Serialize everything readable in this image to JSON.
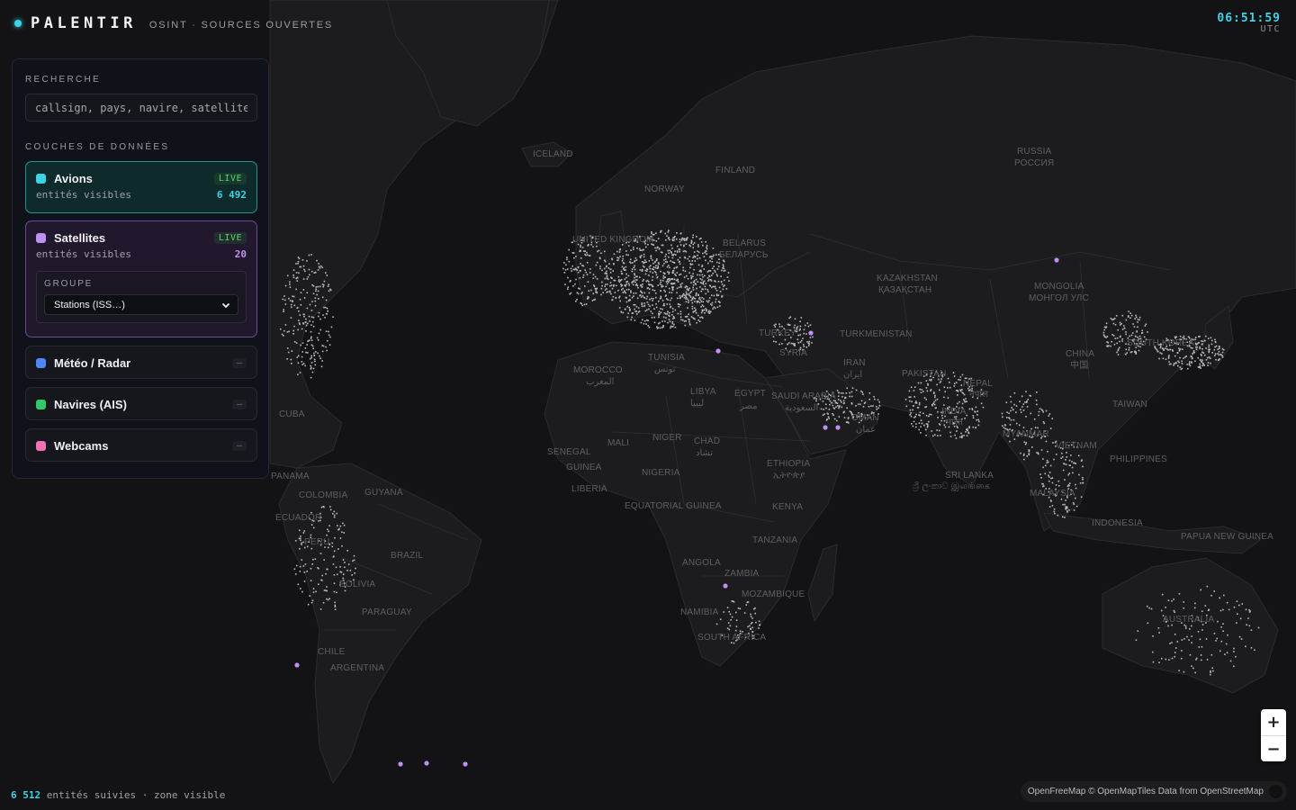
{
  "header": {
    "brand": "PALENTIR",
    "subtitle": "OSINT · SOURCES OUVERTES"
  },
  "clock": {
    "time": "06:51:59",
    "zone": "UTC"
  },
  "panel": {
    "search_title": "RECHERCHE",
    "search_placeholder": "callsign, pays, navire, satellite",
    "layers_title": "COUCHES DE DONNÉES",
    "layers": [
      {
        "name": "Avions",
        "status": "LIVE",
        "sub_label": "entités visibles",
        "count": "6 492",
        "color": "#3fd3e6"
      },
      {
        "name": "Satellites",
        "status": "LIVE",
        "sub_label": "entités visibles",
        "count": "20",
        "color": "#c08ff0",
        "group_title": "GROUPE",
        "group_value": "Stations (ISS…)"
      },
      {
        "name": "Météo / Radar",
        "status": "–",
        "color": "#4f86f7"
      },
      {
        "name": "Navires (AIS)",
        "status": "–",
        "color": "#34c76a"
      },
      {
        "name": "Webcams",
        "status": "–",
        "color": "#f072b6"
      }
    ]
  },
  "map": {
    "labels": [
      "ICELAND",
      "FINLAND",
      "NORWAY",
      "UNITED KINGDOM",
      "BELARUS",
      "БЕЛАРУСЬ",
      "RUSSIA",
      "РОССИЯ",
      "KAZAKHSTAN",
      "ҚАЗАҚСТАН",
      "MONGOLIA",
      "МОНГОЛ УЛС",
      "TURKMENISTAN",
      "TURKEY",
      "SYRIA",
      "IRAN",
      "ایران",
      "PAKISTAN",
      "NEPAL",
      "नेपाल",
      "INDIA",
      "भारत",
      "CHINA",
      "中国",
      "SOUTH KOREA",
      "TAIWAN",
      "MYANMAR",
      "VIETNAM",
      "PHILIPPINES",
      "SRI LANKA",
      "ශ්‍රී ලංකාව இலங்கை",
      "MALAYSIA",
      "INDONESIA",
      "PAPUA NEW GUINEA",
      "AUSTRALIA",
      "MOROCCO",
      "المغرب",
      "TUNISIA",
      "تونس",
      "LIBYA",
      "ليبيا",
      "EGYPT",
      "مصر",
      "SAUDI ARABIA",
      "السعودية",
      "OMAN",
      "عمان",
      "SENEGAL",
      "MALI",
      "NIGER",
      "CHAD",
      "تشاد",
      "GUINEA",
      "NIGERIA",
      "LIBERIA",
      "ETHIOPIA",
      "ኢትዮጵያ",
      "EQUATORIAL GUINEA",
      "KENYA",
      "TANZANIA",
      "ANGOLA",
      "ZAMBIA",
      "MOZAMBIQUE",
      "NAMIBIA",
      "SOUTH AFRICA",
      "CUBA",
      "PANAMA",
      "COLOMBIA",
      "GUYANA",
      "ECUADOR",
      "PERU",
      "BRAZIL",
      "BOLIVIA",
      "PARAGUAY",
      "CHILE",
      "ARGENTINA"
    ]
  },
  "zoom": {
    "in": "+",
    "out": "−"
  },
  "footer": {
    "count": "6 512",
    "status": "entités suivies · zone visible"
  },
  "attribution": "OpenFreeMap © OpenMapTiles Data from OpenStreetMap"
}
